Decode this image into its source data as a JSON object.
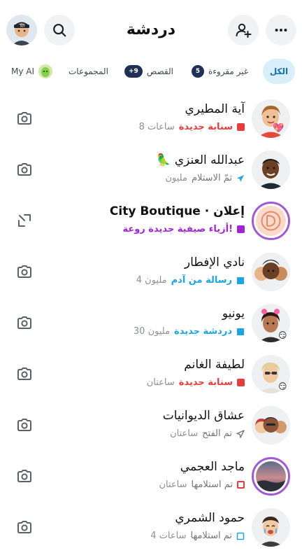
{
  "header": {
    "title": "دردشة"
  },
  "filters": [
    {
      "label": "الكل",
      "active": true
    },
    {
      "label": "غير مقروءة",
      "count": "5"
    },
    {
      "label": "القصص",
      "count": "+9"
    },
    {
      "label": "المجموعات"
    },
    {
      "label": "My AI"
    }
  ],
  "chats": [
    {
      "name": "آية المطيري",
      "status": "سنابة جديدة",
      "time": "8 ساعات",
      "status_color": "#e93b3b",
      "icon": "red-snap-square",
      "trailing": "camera-icon",
      "emoji": "💖"
    },
    {
      "name": "عبدالله العنزي 🦜",
      "status": "تمّ الاستلام",
      "time": "مليون",
      "status_color": "#6f7680",
      "icon": "sent-arrow-blue",
      "trailing": "camera-icon"
    },
    {
      "name": "إعلان · City Boutique",
      "status": "أزياء صيفية جديدة روعة!",
      "time": "",
      "status_color": "#a024d6",
      "icon": "purple-square",
      "trailing": "expand-icon"
    },
    {
      "name": "نادي الإفطار",
      "status": "رسالة من آدم",
      "time": "4 مليون",
      "status_color": "#1aa6e5",
      "icon": "blue-chat-bubble",
      "trailing": "camera-icon"
    },
    {
      "name": "يونيو",
      "status": "دردشة جديدة",
      "time": "30 مليون",
      "status_color": "#1aa6e5",
      "icon": "blue-chat-bubble",
      "trailing": "camera-icon",
      "emoji": "😏"
    },
    {
      "name": "لطيفة الغانم",
      "status": "سنابة جديدة",
      "time": "ساعتان",
      "status_color": "#e93b3b",
      "icon": "red-snap-square",
      "trailing": "camera-icon",
      "emoji": "😏"
    },
    {
      "name": "عشاق الديوانيات",
      "status": "تم الفتح",
      "time": "ساعتان",
      "status_color": "#6f7680",
      "icon": "opened-arrow",
      "trailing": "camera-icon"
    },
    {
      "name": "ماجد العجمي",
      "status": "تم استلامها",
      "time": "ساعتان",
      "status_color": "#6f7680",
      "icon": "red-hollow-square",
      "trailing": "camera-icon"
    },
    {
      "name": "حمود الشمري",
      "status": "تم استلامها",
      "time": "4 ساعات",
      "status_color": "#6f7680",
      "icon": "blue-hollow-bubble",
      "trailing": "camera-icon"
    }
  ],
  "colors": {
    "accent": "#1aa6e5",
    "snap_red": "#e93b3b",
    "ad_purple": "#a024d6",
    "chip_active_bg": "#d8eefb",
    "badge_bg": "#1f2f55"
  }
}
